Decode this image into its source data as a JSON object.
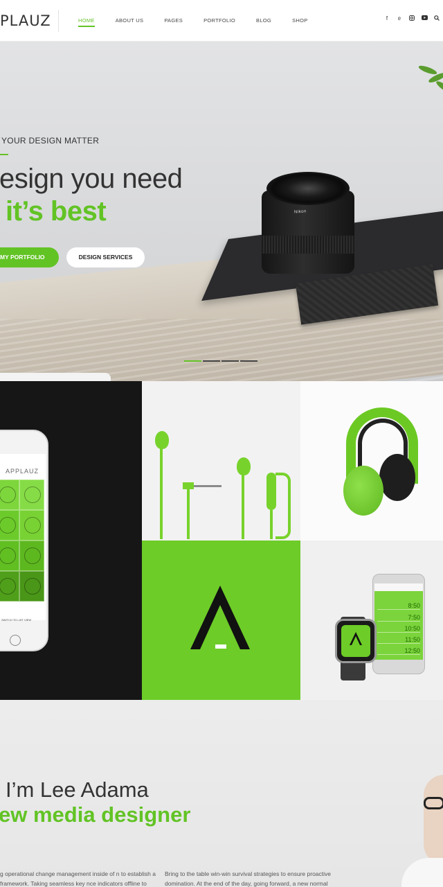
{
  "header": {
    "logo": "PLAUZ",
    "nav": [
      {
        "label": "HOME",
        "active": true
      },
      {
        "label": "ABOUT US",
        "active": false
      },
      {
        "label": "PAGES",
        "active": false
      },
      {
        "label": "PORTFOLIO",
        "active": false
      },
      {
        "label": "BLOG",
        "active": false
      },
      {
        "label": "SHOP",
        "active": false
      }
    ],
    "social": [
      "facebook-icon",
      "twitter-icon",
      "instagram-icon",
      "youtube-icon",
      "search-icon"
    ]
  },
  "hero": {
    "eyebrow": "YOUR DESIGN MATTER",
    "line1": "esign you need",
    "line2": "it’s best",
    "primary_button": "MY PORTFOLIO",
    "secondary_button": "DESIGN SERVICES",
    "slides_total": 4,
    "active_slide": 1,
    "lens_text": "Nikon"
  },
  "portfolio": {
    "phone_app_title": "APPLAUZ",
    "phone_footer": "SWITCH TO LIST VIEW",
    "watch_times": [
      "8:50",
      "7:50",
      "10:50",
      "11:50",
      "12:50"
    ]
  },
  "about": {
    "name": "I’m Lee Adama",
    "role": "ew media designer",
    "col1": "g operational change management inside of n to establish a framework. Taking seamless key nce indicators offline to maximise the long tail. r eye on the ball while performing a deep dive",
    "col2": "Bring to the table win-win survival strategies to ensure proactive domination. At the end of the day, going forward, a new normal that has evolved from generation X is on the runway heading towards a streamlined cloud solution. User"
  },
  "colors": {
    "accent": "#62c325",
    "dark": "#161616",
    "text": "#333333"
  }
}
